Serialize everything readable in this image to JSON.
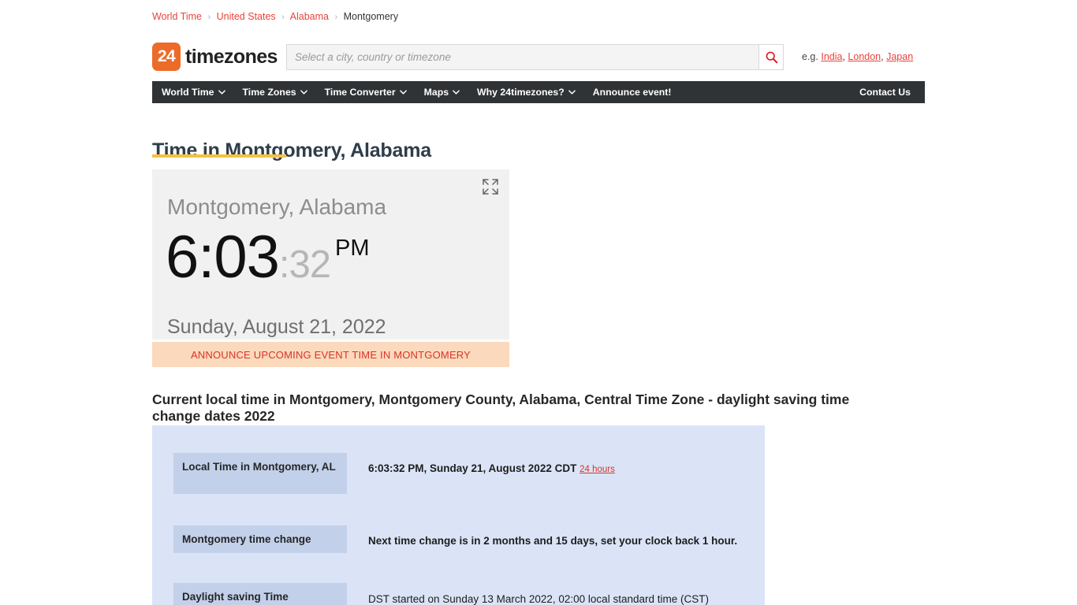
{
  "breadcrumb": {
    "items": [
      {
        "label": "World Time",
        "link": true
      },
      {
        "label": "United States",
        "link": true
      },
      {
        "label": "Alabama",
        "link": true
      },
      {
        "label": "Montgomery",
        "link": false
      }
    ],
    "separator": "›"
  },
  "header": {
    "logo_badge": "24",
    "logo_word": "timezones",
    "search": {
      "placeholder": "Select a city, country or timezone",
      "value": "",
      "icon": "search-icon"
    },
    "examples_prefix": "e.g.",
    "examples": [
      "India",
      "London",
      "Japan"
    ],
    "examples_separator": ","
  },
  "nav": {
    "items": [
      {
        "label": "World Time",
        "caret": true
      },
      {
        "label": "Time Zones",
        "caret": true
      },
      {
        "label": "Time Converter",
        "caret": true
      },
      {
        "label": "Maps",
        "caret": true
      },
      {
        "label": "Why 24timezones?",
        "caret": true
      },
      {
        "label": "Announce event!",
        "caret": false
      }
    ],
    "right_item": {
      "label": "Contact Us"
    }
  },
  "main": {
    "page_title": "Time in Montgomery, Alabama",
    "clock": {
      "city": "Montgomery, Alabama",
      "hours_minutes": "6:03",
      "seconds": ":32",
      "meridiem": "PM",
      "date": "Sunday, August 21, 2022",
      "expand_icon": "fullscreen-icon"
    },
    "announce_banner": "ANNOUNCE UPCOMING EVENT TIME IN MONTGOMERY",
    "section_heading": "Current local time in Montgomery, Montgomery County, Alabama, Central Time Zone - daylight saving time change dates 2022",
    "info_rows": [
      {
        "label": "Local Time in Montgomery, AL",
        "value": "6:03:32 PM, Sunday 21, August 2022 CDT",
        "link": "24 hours"
      },
      {
        "label": "Montgomery time change",
        "value": "Next time change is in 2 months and 15 days, set your clock back 1 hour.",
        "link": ""
      },
      {
        "label": "Daylight saving Time",
        "value": "DST started on Sunday 13 March 2022, 02:00 local standard time (CST)",
        "link": ""
      }
    ]
  },
  "colors": {
    "brand_orange": "#ed6b28",
    "link_red": "#e8433c",
    "nav_dark": "#2f3336",
    "accent_gold": "#f4c241",
    "panel_blue": "#dbe4f7",
    "label_blue": "#c2d0ea",
    "banner_peach": "#fbd9bc"
  }
}
